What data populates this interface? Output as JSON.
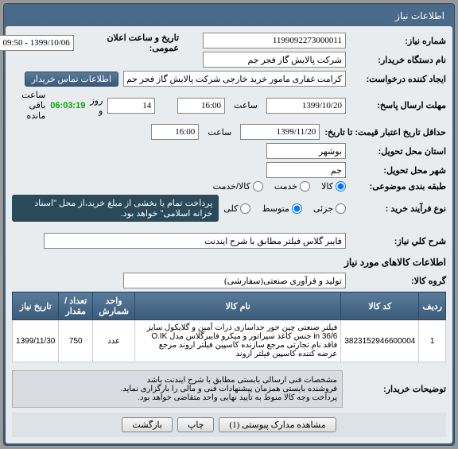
{
  "panel": {
    "title": "اطلاعات نیاز"
  },
  "labels": {
    "need_number": "شماره نیاز:",
    "buyer_org": "نام دستگاه خریدار:",
    "announce_datetime": "تاریخ و ساعت اعلان عمومی:",
    "creator": "ایجاد کننده درخواست:",
    "contact": "اطلاعات تماس خریدار",
    "deadline": "مهلت ارسال پاسخ:",
    "to_date": "تا تاریخ:",
    "credit_deadline": "حداقل تاریخ اعتبار قیمت: تا تاریخ:",
    "delivery_state": "استان محل تحویل:",
    "delivery_city": "شهر محل تحویل:",
    "classification": "طبقه بندی موضوعی:",
    "process_type": "نوع فرآیند خرید :",
    "need_desc": "شرح کلي نياز:",
    "items_title": "اطلاعات کالاهای مورد نیاز",
    "item_group": "گروه کالا:",
    "buyer_remarks": "توضیحات خریدار:",
    "hour": "ساعت",
    "day_remain": "روز و",
    "hour_remain": "ساعت باقی مانده",
    "row": "ردیف",
    "item_code": "کد کالا",
    "item_name": "نام کالا",
    "unit": "واحد شمارش",
    "qty": "تعداد / مقدار",
    "need_date": "تاریخ نیاز"
  },
  "values": {
    "need_number": "1199092273000011",
    "buyer_org": "شرکت پالایش گاز فجر جم",
    "announce_datetime": "1399/10/06 - 09:50",
    "creator": "کرامت غفاری مامور خرید خارجی شرکت پالایش گاز فجر جم",
    "deadline_date": "1399/10/20",
    "deadline_time": "16:00",
    "credit_date": "1399/11/20",
    "credit_time": "16:00",
    "delivery_state": "بوشهر",
    "delivery_city": "جم",
    "day_num": "14",
    "timer": "06:03:19",
    "need_desc": "فایبر گلاس فیلتر مطابق با شرح ایندنت",
    "item_group": "تولید و فرآوری صنعتی(سفارشی)",
    "process_note": "پرداخت تمام یا بخشی از مبلغ خرید،از محل \"اسناد خزانه اسلامی\" خواهد بود."
  },
  "classification": {
    "goods": "کالا",
    "service": "خدمت",
    "goods_service": "کالا/خدمت"
  },
  "process": {
    "low": "جزئی",
    "mid": "متوسط",
    "high": "کلی"
  },
  "table": {
    "rows": [
      {
        "idx": "1",
        "code": "3823152946600004",
        "name": "فیلتر صنعتی چین خور جداسازی ذرات آمین و گلایکول سایز in 36/6 جنس کاغذ سپراتور و میکرو فایبرگلاس مدل O.IK فاقد نام تجارتی مرجع سازنده کاسپین فیلتر اروند مرجع عرضه کننده کاسپین فیلتر اروند",
        "unit": "عدد",
        "qty": "750",
        "date": "1399/11/30"
      }
    ]
  },
  "remarks": "مشخصات فنی ارسالی بابستی مطابق با شرح ایندنت باشد\nفروشنده بایستی همزمان پیشنهادات فنی و مالی را بارگزاری نماید.\nپرداخت وجه کالا منوط به تایید نهایی واحد متقاضی خواهد بود.",
  "buttons": {
    "attachments": "مشاهده مدارک پیوستی (1)",
    "print": "چاپ",
    "exit": "بازگشت"
  }
}
